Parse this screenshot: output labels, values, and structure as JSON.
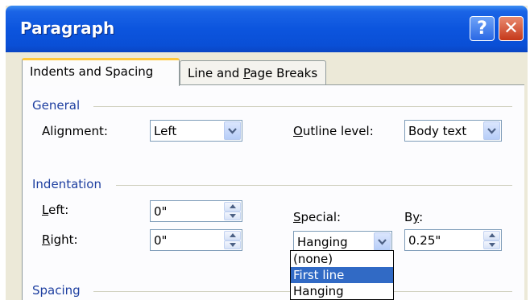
{
  "window": {
    "title": "Paragraph"
  },
  "titlebar_buttons": {
    "help": "?",
    "close": "✕"
  },
  "tabs": [
    {
      "label": "Indents and Spacing",
      "active": true
    },
    {
      "label_pre": "Line and ",
      "label_ul": "P",
      "label_post": "age Breaks",
      "active": false
    }
  ],
  "general": {
    "section_label": "General",
    "alignment": {
      "label_pre": "Alignment:",
      "value": "Left"
    },
    "outline_level": {
      "label_ul": "O",
      "label_post": "utline level:",
      "value": "Body text"
    }
  },
  "indentation": {
    "section_label": "Indentation",
    "left": {
      "label_ul": "L",
      "label_post": "eft:",
      "value": "0\""
    },
    "right": {
      "label_ul": "R",
      "label_post": "ight:",
      "value": "0\""
    },
    "special": {
      "label_ul": "S",
      "label_post": "pecial:",
      "value": "Hanging",
      "options": [
        "(none)",
        "First line",
        "Hanging"
      ],
      "highlighted": "First line"
    },
    "by": {
      "label_pre": "B",
      "label_ul": "y",
      "label_post": ":",
      "value": "0.25\""
    }
  },
  "spacing": {
    "section_label": "Spacing"
  },
  "colors": {
    "title_blue": "#0a4fd6",
    "section_label": "#1e3fa0",
    "selection": "#316ac5",
    "tab_accent": "#ffc83c"
  },
  "icons": {
    "dropdown": "chevron-down-icon",
    "spinner": "spinner-updown-icon",
    "help": "help-icon",
    "close": "close-icon"
  }
}
